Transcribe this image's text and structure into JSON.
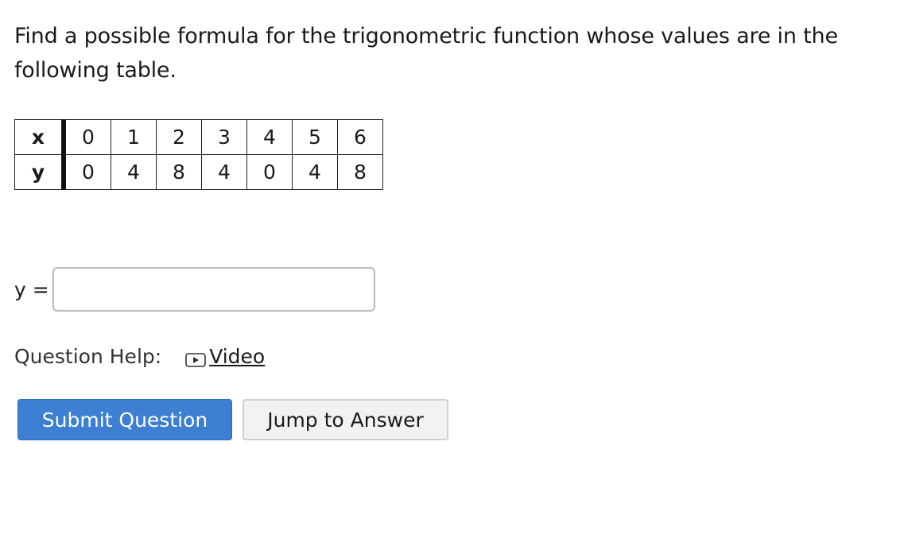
{
  "question": {
    "text": "Find a possible formula for the trigonometric function whose values are in the following table."
  },
  "table": {
    "row_x": {
      "header": "x",
      "values": [
        "0",
        "1",
        "2",
        "3",
        "4",
        "5",
        "6"
      ]
    },
    "row_y": {
      "header": "y",
      "values": [
        "0",
        "4",
        "8",
        "4",
        "0",
        "4",
        "8"
      ]
    }
  },
  "answer": {
    "label": "y =",
    "value": "",
    "placeholder": ""
  },
  "help": {
    "label": "Question Help:",
    "video_label": "Video",
    "video_icon": "play-icon"
  },
  "buttons": {
    "submit_label": "Submit Question",
    "jump_label": "Jump to Answer"
  },
  "colors": {
    "submit_bg": "#3c7fd3",
    "jump_bg": "#f2f2f2",
    "input_border": "#b9b9b9"
  }
}
